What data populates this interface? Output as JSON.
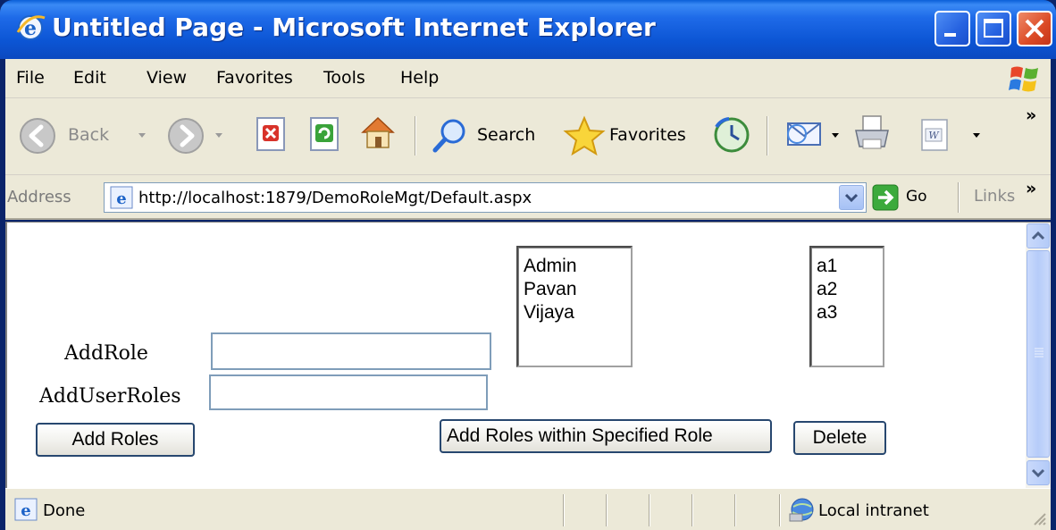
{
  "window": {
    "title": "Untitled Page - Microsoft Internet Explorer"
  },
  "menu": {
    "items": [
      "File",
      "Edit",
      "View",
      "Favorites",
      "Tools",
      "Help"
    ]
  },
  "toolbar": {
    "back_label": "Back",
    "search_label": "Search",
    "favorites_label": "Favorites",
    "more": "»"
  },
  "address": {
    "label": "Address",
    "url": "http://localhost:1879/DemoRoleMgt/Default.aspx",
    "go_label": "Go",
    "links_label": "Links",
    "more": "»"
  },
  "form": {
    "add_role_label": "AddRole",
    "add_role_value": "",
    "add_user_roles_label": "AddUserRoles",
    "add_user_roles_value": "",
    "add_roles_button": "Add Roles",
    "add_roles_within_button": "Add Roles within Specified Role",
    "delete_button": "Delete",
    "roles_list": [
      "Admin",
      "Pavan",
      "Vijaya"
    ],
    "users_list": [
      "a1",
      "a2",
      "a3"
    ]
  },
  "status": {
    "text": "Done",
    "zone": "Local intranet"
  }
}
